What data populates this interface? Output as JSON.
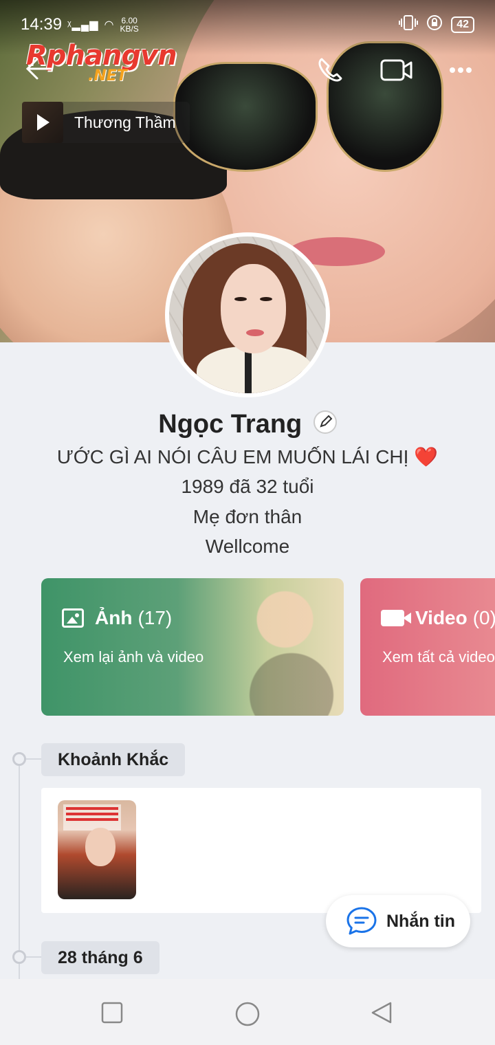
{
  "status_bar": {
    "time": "14:39",
    "net_speed_value": "6.00",
    "net_speed_unit": "KB/S",
    "battery": "42"
  },
  "watermark": {
    "line1": "Rphangvn",
    "line2": ".NET"
  },
  "music": {
    "title": "Thương Thầm"
  },
  "profile": {
    "name": "Ngọc Trang",
    "bio_line1": "ƯỚC GÌ AI NÓI CÂU EM MUỐN LÁI CHỊ",
    "bio_heart": "❤️",
    "bio_line2": "1989 đã 32 tuổi",
    "bio_line3": "Mẹ đơn thân",
    "bio_line4": "Wellcome"
  },
  "cards": {
    "photo": {
      "label": "Ảnh",
      "count": "(17)",
      "subtitle": "Xem lại ảnh và video"
    },
    "video": {
      "label": "Video",
      "count": "(0)",
      "subtitle": "Xem tất cả video"
    }
  },
  "timeline": {
    "section1": "Khoảnh Khắc",
    "section2": "28 tháng 6"
  },
  "chat_button": {
    "label": "Nhắn tin"
  },
  "colors": {
    "photo_card_start": "#3f9468",
    "video_card": "#e06a7e",
    "accent_blue": "#1a73e8"
  }
}
